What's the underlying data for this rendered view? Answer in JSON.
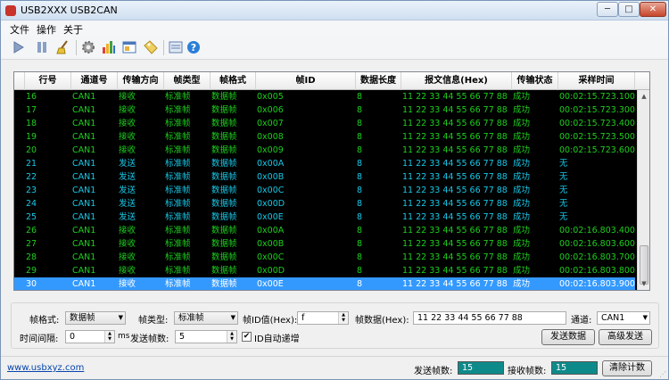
{
  "window": {
    "title": "USB2XXX USB2CAN",
    "min_label": "─",
    "max_label": "□",
    "close_label": "✕"
  },
  "menu": {
    "items": [
      "文件",
      "操作",
      "关于"
    ]
  },
  "toolbar": {
    "icons": [
      "play-icon",
      "pause-icon",
      "broom-icon",
      "gear-icon",
      "bar-chart-icon",
      "window-icon",
      "tag-icon",
      "panel-icon",
      "help-icon"
    ]
  },
  "grid": {
    "columns": [
      "行号",
      "通道号",
      "传输方向",
      "帧类型",
      "帧格式",
      "帧ID",
      "数据长度",
      "报文信息(Hex)",
      "传输状态",
      "采样时间"
    ],
    "rows": [
      {
        "no": "16",
        "ch": "CAN1",
        "dir": "接收",
        "type": "标准帧",
        "fmt": "数据帧",
        "id": "0x005",
        "len": "8",
        "data": "11 22 33 44 55 66 77 88",
        "status": "成功",
        "time": "00:02:15.723.100",
        "color": "#1ecf1e"
      },
      {
        "no": "17",
        "ch": "CAN1",
        "dir": "接收",
        "type": "标准帧",
        "fmt": "数据帧",
        "id": "0x006",
        "len": "8",
        "data": "11 22 33 44 55 66 77 88",
        "status": "成功",
        "time": "00:02:15.723.300",
        "color": "#1ecf1e"
      },
      {
        "no": "18",
        "ch": "CAN1",
        "dir": "接收",
        "type": "标准帧",
        "fmt": "数据帧",
        "id": "0x007",
        "len": "8",
        "data": "11 22 33 44 55 66 77 88",
        "status": "成功",
        "time": "00:02:15.723.400",
        "color": "#1ecf1e"
      },
      {
        "no": "19",
        "ch": "CAN1",
        "dir": "接收",
        "type": "标准帧",
        "fmt": "数据帧",
        "id": "0x008",
        "len": "8",
        "data": "11 22 33 44 55 66 77 88",
        "status": "成功",
        "time": "00:02:15.723.500",
        "color": "#1ecf1e"
      },
      {
        "no": "20",
        "ch": "CAN1",
        "dir": "接收",
        "type": "标准帧",
        "fmt": "数据帧",
        "id": "0x009",
        "len": "8",
        "data": "11 22 33 44 55 66 77 88",
        "status": "成功",
        "time": "00:02:15.723.600",
        "color": "#1ecf1e"
      },
      {
        "no": "21",
        "ch": "CAN1",
        "dir": "发送",
        "type": "标准帧",
        "fmt": "数据帧",
        "id": "0x00A",
        "len": "8",
        "data": "11 22 33 44 55 66 77 88",
        "status": "成功",
        "time": "无",
        "color": "#19c8e8"
      },
      {
        "no": "22",
        "ch": "CAN1",
        "dir": "发送",
        "type": "标准帧",
        "fmt": "数据帧",
        "id": "0x00B",
        "len": "8",
        "data": "11 22 33 44 55 66 77 88",
        "status": "成功",
        "time": "无",
        "color": "#19c8e8"
      },
      {
        "no": "23",
        "ch": "CAN1",
        "dir": "发送",
        "type": "标准帧",
        "fmt": "数据帧",
        "id": "0x00C",
        "len": "8",
        "data": "11 22 33 44 55 66 77 88",
        "status": "成功",
        "time": "无",
        "color": "#19c8e8"
      },
      {
        "no": "24",
        "ch": "CAN1",
        "dir": "发送",
        "type": "标准帧",
        "fmt": "数据帧",
        "id": "0x00D",
        "len": "8",
        "data": "11 22 33 44 55 66 77 88",
        "status": "成功",
        "time": "无",
        "color": "#19c8e8"
      },
      {
        "no": "25",
        "ch": "CAN1",
        "dir": "发送",
        "type": "标准帧",
        "fmt": "数据帧",
        "id": "0x00E",
        "len": "8",
        "data": "11 22 33 44 55 66 77 88",
        "status": "成功",
        "time": "无",
        "color": "#19c8e8"
      },
      {
        "no": "26",
        "ch": "CAN1",
        "dir": "接收",
        "type": "标准帧",
        "fmt": "数据帧",
        "id": "0x00A",
        "len": "8",
        "data": "11 22 33 44 55 66 77 88",
        "status": "成功",
        "time": "00:02:16.803.400",
        "color": "#1ecf1e"
      },
      {
        "no": "27",
        "ch": "CAN1",
        "dir": "接收",
        "type": "标准帧",
        "fmt": "数据帧",
        "id": "0x00B",
        "len": "8",
        "data": "11 22 33 44 55 66 77 88",
        "status": "成功",
        "time": "00:02:16.803.600",
        "color": "#1ecf1e"
      },
      {
        "no": "28",
        "ch": "CAN1",
        "dir": "接收",
        "type": "标准帧",
        "fmt": "数据帧",
        "id": "0x00C",
        "len": "8",
        "data": "11 22 33 44 55 66 77 88",
        "status": "成功",
        "time": "00:02:16.803.700",
        "color": "#1ecf1e"
      },
      {
        "no": "29",
        "ch": "CAN1",
        "dir": "接收",
        "type": "标准帧",
        "fmt": "数据帧",
        "id": "0x00D",
        "len": "8",
        "data": "11 22 33 44 55 66 77 88",
        "status": "成功",
        "time": "00:02:16.803.800",
        "color": "#1ecf1e"
      },
      {
        "no": "30",
        "ch": "CAN1",
        "dir": "接收",
        "type": "标准帧",
        "fmt": "数据帧",
        "id": "0x00E",
        "len": "8",
        "data": "11 22 33 44 55 66 77 88",
        "status": "成功",
        "time": "00:02:16.803.900",
        "color": "#ffffff",
        "selected": true
      }
    ]
  },
  "form": {
    "frame_format_label": "帧格式:",
    "frame_format_value": "数据帧",
    "frame_type_label": "帧类型:",
    "frame_type_value": "标准帧",
    "frame_id_label": "帧ID值(Hex):",
    "frame_id_value": "f",
    "frame_data_label": "帧数据(Hex):",
    "frame_data_value": "11 22 33 44 55 66 77 88",
    "channel_label": "通道:",
    "channel_value": "CAN1",
    "interval_label": "时间间隔:",
    "interval_value": "0",
    "interval_unit": "ms",
    "send_count_label": "发送帧数:",
    "send_count_value": "5",
    "auto_inc_label": "ID自动递增",
    "auto_inc_checked": "✔",
    "send_button": "发送数据",
    "advanced_button": "高级发送"
  },
  "status": {
    "link": "www.usbxyz.com",
    "sent_label": "发送帧数:",
    "sent_value": "15",
    "recv_label": "接收帧数:",
    "recv_value": "15",
    "clear_button": "清除计数"
  }
}
